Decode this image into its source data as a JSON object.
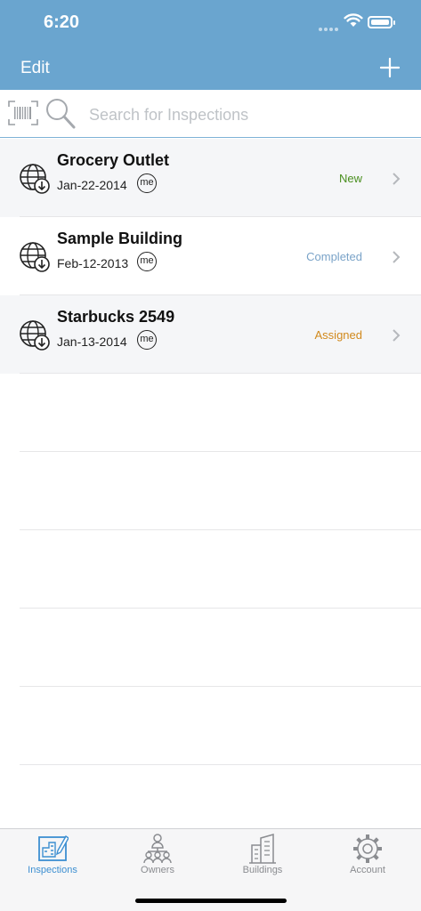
{
  "status_bar": {
    "time": "6:20"
  },
  "nav": {
    "edit_label": "Edit",
    "add_icon": "plus-icon"
  },
  "search": {
    "placeholder": "Search for Inspections"
  },
  "inspections": [
    {
      "name": "Grocery Outlet",
      "date": "Jan-22-2014",
      "owner_badge": "me",
      "status": "New",
      "status_color": "#4a8f1f"
    },
    {
      "name": "Sample Building",
      "date": "Feb-12-2013",
      "owner_badge": "me",
      "status": "Completed",
      "status_color": "#7aa3c8"
    },
    {
      "name": "Starbucks 2549",
      "date": "Jan-13-2014",
      "owner_badge": "me",
      "status": "Assigned",
      "status_color": "#d1891c"
    }
  ],
  "tabs": [
    {
      "label": "Inspections",
      "icon": "inspections-icon",
      "active": true
    },
    {
      "label": "Owners",
      "icon": "owners-icon",
      "active": false
    },
    {
      "label": "Buildings",
      "icon": "buildings-icon",
      "active": false
    },
    {
      "label": "Account",
      "icon": "gear-icon",
      "active": false
    }
  ],
  "colors": {
    "nav_bar": "#6aa5cf",
    "accent": "#3d8fd1"
  }
}
